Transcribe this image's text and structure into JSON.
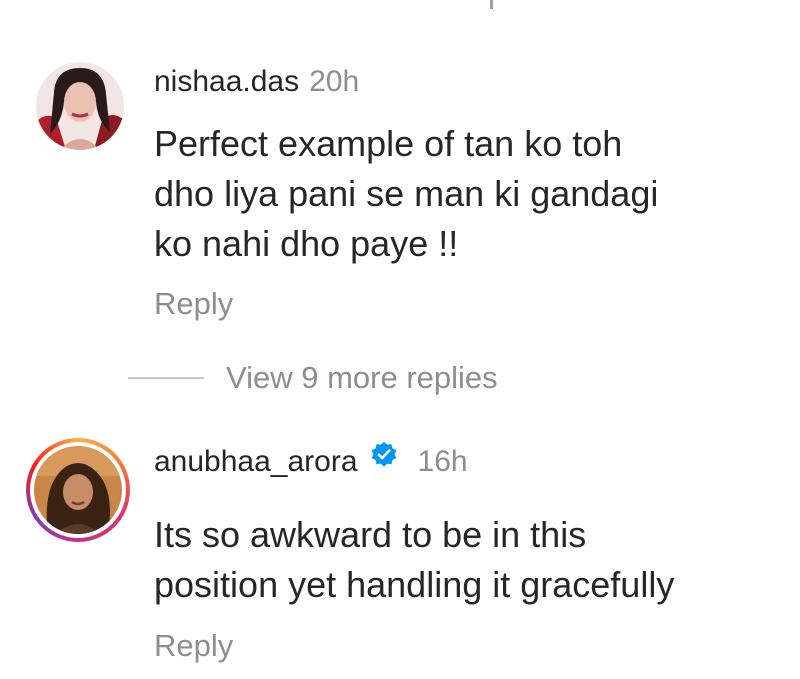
{
  "comments": [
    {
      "username": "nishaa.das",
      "time": "20h",
      "text": "Perfect example of tan ko toh\ndho liya pani se man ki gandagi\nko nahi dho paye !!",
      "reply_label": "Reply",
      "avatar_icon": "profile-photo",
      "verified": false
    },
    {
      "username": "anubhaa_arora",
      "time": "16h",
      "text": "Its so awkward to be in this\nposition yet handling it gracefully",
      "reply_label": "Reply",
      "avatar_icon": "profile-photo-with-story-ring",
      "verified": true,
      "verified_color": "#0095f6"
    }
  ],
  "view_replies": {
    "label": "View 9 more replies"
  },
  "colors": {
    "text_primary": "#262626",
    "text_secondary": "#8e8e8e",
    "verified_blue": "#0095f6"
  }
}
